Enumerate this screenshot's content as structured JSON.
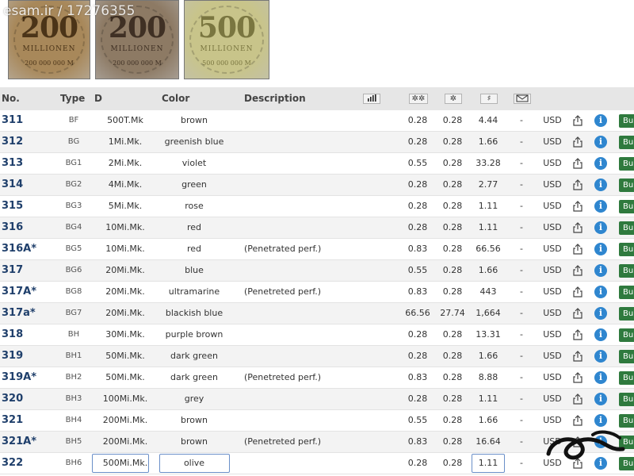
{
  "watermark": "esam.ir / 17276355",
  "stamps": [
    {
      "value": "200",
      "word": "MILLIONEN",
      "small": "200 000 000 M",
      "bg": "#a8885a",
      "fg": "#4b3418"
    },
    {
      "value": "200",
      "word": "MILLIONEN",
      "small": "200 000 000 M",
      "bg": "#8d7a64",
      "fg": "#3f3024"
    },
    {
      "value": "500",
      "word": "MILLIONEN",
      "small": "500 000 000 M",
      "bg": "#c8c48a",
      "fg": "#7a7640"
    }
  ],
  "header": {
    "no": "No.",
    "type": "Type",
    "d": "D",
    "color": "Color",
    "description": "Description",
    "icons": [
      "chart-icon",
      "mint-never-hinged-icon",
      "mint-hinged-icon",
      "used-icon",
      "cover-icon"
    ]
  },
  "rows": [
    {
      "no": "311",
      "type": "BF",
      "denom": "500T.Mk",
      "color": "brown",
      "desc": "",
      "p1": "0.28",
      "p2": "0.28",
      "p3": "4.44",
      "dash": "-",
      "cur": "USD",
      "buy": "Bu"
    },
    {
      "no": "312",
      "type": "BG",
      "denom": "1Mi.Mk.",
      "color": "greenish blue",
      "desc": "",
      "p1": "0.28",
      "p2": "0.28",
      "p3": "1.66",
      "dash": "-",
      "cur": "USD",
      "buy": "Bu"
    },
    {
      "no": "313",
      "type": "BG1",
      "denom": "2Mi.Mk.",
      "color": "violet",
      "desc": "",
      "p1": "0.55",
      "p2": "0.28",
      "p3": "33.28",
      "dash": "-",
      "cur": "USD",
      "buy": "Bu"
    },
    {
      "no": "314",
      "type": "BG2",
      "denom": "4Mi.Mk.",
      "color": "green",
      "desc": "",
      "p1": "0.28",
      "p2": "0.28",
      "p3": "2.77",
      "dash": "-",
      "cur": "USD",
      "buy": "Bu"
    },
    {
      "no": "315",
      "type": "BG3",
      "denom": "5Mi.Mk.",
      "color": "rose",
      "desc": "",
      "p1": "0.28",
      "p2": "0.28",
      "p3": "1.11",
      "dash": "-",
      "cur": "USD",
      "buy": "Bu"
    },
    {
      "no": "316",
      "type": "BG4",
      "denom": "10Mi.Mk.",
      "color": "red",
      "desc": "",
      "p1": "0.28",
      "p2": "0.28",
      "p3": "1.11",
      "dash": "-",
      "cur": "USD",
      "buy": "Bu"
    },
    {
      "no": "316A*",
      "type": "BG5",
      "denom": "10Mi.Mk.",
      "color": "red",
      "desc": "(Penetrated perf.)",
      "p1": "0.83",
      "p2": "0.28",
      "p3": "66.56",
      "dash": "-",
      "cur": "USD",
      "buy": "Bu"
    },
    {
      "no": "317",
      "type": "BG6",
      "denom": "20Mi.Mk.",
      "color": "blue",
      "desc": "",
      "p1": "0.55",
      "p2": "0.28",
      "p3": "1.66",
      "dash": "-",
      "cur": "USD",
      "buy": "Bu"
    },
    {
      "no": "317A*",
      "type": "BG8",
      "denom": "20Mi.Mk.",
      "color": "ultramarine",
      "desc": "(Penetreted perf.)",
      "p1": "0.83",
      "p2": "0.28",
      "p3": "443",
      "dash": "-",
      "cur": "USD",
      "buy": "Bu"
    },
    {
      "no": "317a*",
      "type": "BG7",
      "denom": "20Mi.Mk.",
      "color": "blackish blue",
      "desc": "",
      "p1": "66.56",
      "p2": "27.74",
      "p3": "1,664",
      "dash": "-",
      "cur": "USD",
      "buy": "Bu"
    },
    {
      "no": "318",
      "type": "BH",
      "denom": "30Mi.Mk.",
      "color": "purple brown",
      "desc": "",
      "p1": "0.28",
      "p2": "0.28",
      "p3": "13.31",
      "dash": "-",
      "cur": "USD",
      "buy": "Bu"
    },
    {
      "no": "319",
      "type": "BH1",
      "denom": "50Mi.Mk.",
      "color": "dark green",
      "desc": "",
      "p1": "0.28",
      "p2": "0.28",
      "p3": "1.66",
      "dash": "-",
      "cur": "USD",
      "buy": "Bu"
    },
    {
      "no": "319A*",
      "type": "BH2",
      "denom": "50Mi.Mk.",
      "color": "dark green",
      "desc": "(Penetreted perf.)",
      "p1": "0.83",
      "p2": "0.28",
      "p3": "8.88",
      "dash": "-",
      "cur": "USD",
      "buy": "Bu"
    },
    {
      "no": "320",
      "type": "BH3",
      "denom": "100Mi.Mk.",
      "color": "grey",
      "desc": "",
      "p1": "0.28",
      "p2": "0.28",
      "p3": "1.11",
      "dash": "-",
      "cur": "USD",
      "buy": "Bu"
    },
    {
      "no": "321",
      "type": "BH4",
      "denom": "200Mi.Mk.",
      "color": "brown",
      "desc": "",
      "p1": "0.55",
      "p2": "0.28",
      "p3": "1.66",
      "dash": "-",
      "cur": "USD",
      "buy": "Bu"
    },
    {
      "no": "321A*",
      "type": "BH5",
      "denom": "200Mi.Mk.",
      "color": "brown",
      "desc": "(Penetreted perf.)",
      "p1": "0.83",
      "p2": "0.28",
      "p3": "16.64",
      "dash": "-",
      "cur": "USD",
      "buy": "Bu"
    },
    {
      "no": "322",
      "type": "BH6",
      "denom": "500Mi.Mk.",
      "color": "olive",
      "desc": "",
      "p1": "0.28",
      "p2": "0.28",
      "p3": "1.11",
      "dash": "-",
      "cur": "USD",
      "buy": "Bu"
    }
  ],
  "colors": {
    "number": "#1f3f6b",
    "buy": "#2f7a3e",
    "info": "#2f86cf",
    "header_bg": "#e6e6e6"
  }
}
